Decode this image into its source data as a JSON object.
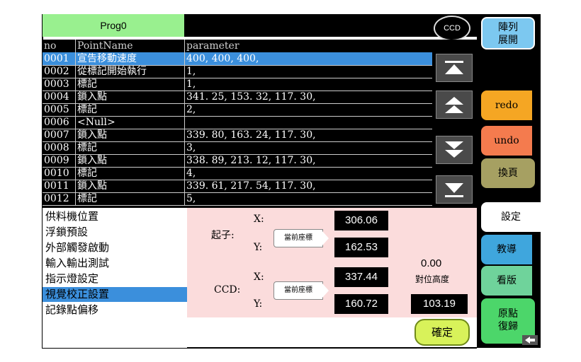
{
  "header": {
    "program_tab": "Prog0",
    "ccd_button": "CCD"
  },
  "table": {
    "headers": [
      "no",
      "PointName",
      "parameter"
    ],
    "rows": [
      {
        "no": "0001",
        "name": "宣告移動速度",
        "param": "400, 400, 400,"
      },
      {
        "no": "0002",
        "name": "從標記開始執行",
        "param": "1,"
      },
      {
        "no": "0003",
        "name": "標記",
        "param": "1,"
      },
      {
        "no": "0004",
        "name": "鎖入點",
        "param": "341. 25, 153. 32, 117. 30,"
      },
      {
        "no": "0005",
        "name": "標記",
        "param": "2,"
      },
      {
        "no": "0006",
        "name": "<Null>",
        "param": ""
      },
      {
        "no": "0007",
        "name": "鎖入點",
        "param": "339. 80, 163. 24, 117. 30,"
      },
      {
        "no": "0008",
        "name": "標記",
        "param": "3,"
      },
      {
        "no": "0009",
        "name": "鎖入點",
        "param": "338. 89, 213. 12, 117. 30,"
      },
      {
        "no": "0010",
        "name": "標記",
        "param": "4,"
      },
      {
        "no": "0011",
        "name": "鎖入點",
        "param": "339. 61, 217. 54, 117. 30,"
      },
      {
        "no": "0012",
        "name": "標記",
        "param": "5,"
      }
    ]
  },
  "scroll_icons": [
    "scroll-top-icon",
    "scroll-up-icon",
    "scroll-down-icon",
    "scroll-bottom-icon"
  ],
  "sidebar": {
    "array_expand": "陣列\n展開",
    "redo": "redo",
    "undo": "undo",
    "page_switch": "換頁",
    "settings": "設定",
    "teach": "教導",
    "view": "看版",
    "home_return": "原點\n復歸"
  },
  "menu": {
    "items": [
      "供料機位置",
      "浮鎖預設",
      "外部觸發啟動",
      "輸入輸出測試",
      "指示燈設定",
      "視覺校正設置",
      "記錄點偏移"
    ],
    "selected_index": 5
  },
  "calibration": {
    "screwdriver_label": "起子:",
    "ccd_label": "CCD:",
    "x_label": "X:",
    "y_label": "Y:",
    "current_coords_label": "當前座標",
    "screwdriver_x": "306.06",
    "screwdriver_y": "162.53",
    "ccd_x": "337.44",
    "ccd_y": "160.72",
    "offset_value": "0.00",
    "align_height_label": "對位高度",
    "align_height": "103.19"
  },
  "confirm_button": "確定",
  "colors": {
    "selection": "#3b8fdc",
    "prog_tab": "#99f08f",
    "redo": "#f5a623",
    "undo": "#f47b4e",
    "page_switch": "#a6a062",
    "teach": "#3fa6dd",
    "view": "#6fd39b",
    "home_return": "#4cd66a",
    "panel": "#fbdcdc"
  }
}
